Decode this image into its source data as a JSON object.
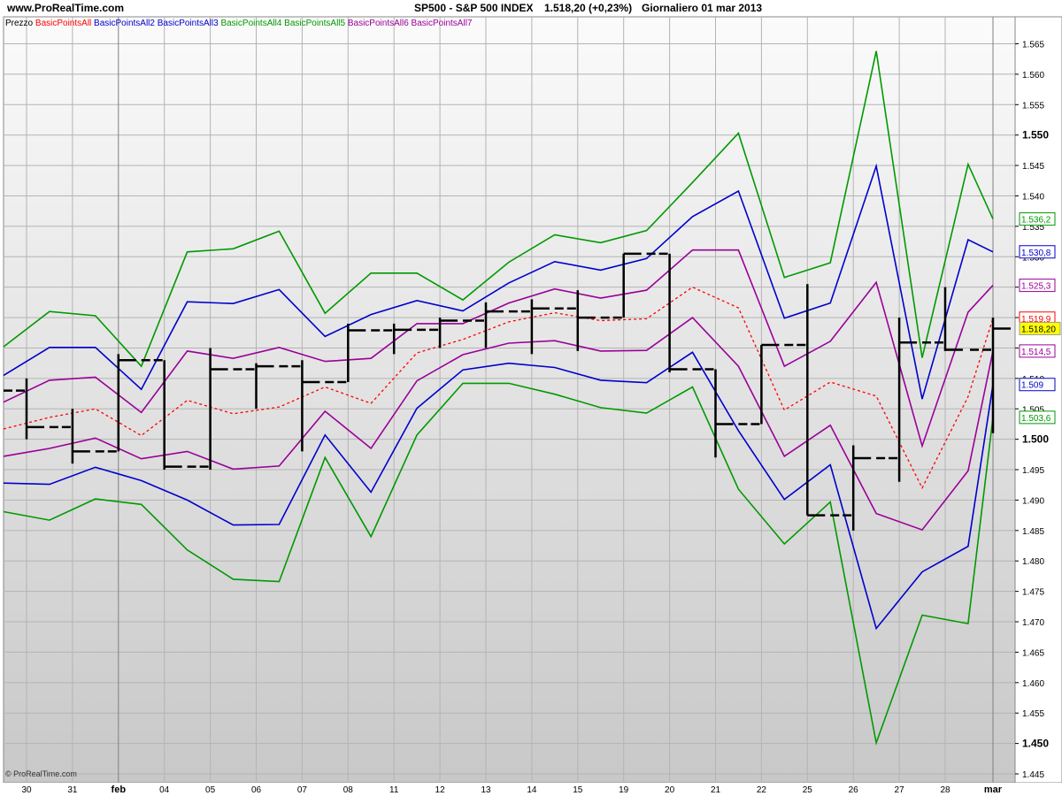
{
  "header": {
    "site": "www.ProRealTime.com",
    "instrument": "SP500 - S&P 500 INDEX",
    "price_change": "1.518,20 (+0,23%)",
    "timeframe_date": "Giornaliero  01 mar 2013"
  },
  "legend": [
    {
      "text": "Prezzo",
      "color": "#000000"
    },
    {
      "text": "BasicPointsAll",
      "color": "#ff0000"
    },
    {
      "text": "BasicPointsAll2",
      "color": "#0000cc"
    },
    {
      "text": "BasicPointsAll3",
      "color": "#0000cc"
    },
    {
      "text": "BasicPointsAll4",
      "color": "#009900"
    },
    {
      "text": "BasicPointsAll5",
      "color": "#009900"
    },
    {
      "text": "BasicPointsAll6",
      "color": "#990099"
    },
    {
      "text": "BasicPointsAll7",
      "color": "#990099"
    }
  ],
  "copyright": "© ProRealTime.com",
  "chart_data": {
    "type": "line",
    "ylim": [
      1444,
      1570
    ],
    "y_ticks": [
      "1.565",
      "1.560",
      "1.555",
      "1.550",
      "1.545",
      "1.540",
      "1.535",
      "1.530",
      "1.525",
      "1.520",
      "1.515",
      "1.510",
      "1.505",
      "1.500",
      "1.495",
      "1.490",
      "1.485",
      "1.480",
      "1.475",
      "1.470",
      "1.465",
      "1.460",
      "1.455",
      "1.450",
      "1.445"
    ],
    "y_ticks_bold": [
      "1.550",
      "1.500",
      "1.450"
    ],
    "x_labels": [
      "30",
      "31",
      "feb",
      "04",
      "05",
      "06",
      "07",
      "08",
      "11",
      "12",
      "13",
      "14",
      "15",
      "19",
      "20",
      "21",
      "22",
      "25",
      "26",
      "27",
      "28",
      "mar"
    ],
    "x_labels_bold": [
      "feb",
      "mar"
    ],
    "series": [
      {
        "name": "BasicPointsAll",
        "color": "#ff0000",
        "dashed": true,
        "values": [
          1501.7,
          1503.6,
          1505.0,
          1500.6,
          1506.4,
          1504.2,
          1505.3,
          1508.6,
          1505.9,
          1514.2,
          1516.4,
          1519.3,
          1520.8,
          1519.5,
          1519.8,
          1525.0,
          1521.6,
          1504.8,
          1509.4,
          1507.1,
          1492.0,
          1507.0,
          1519.9
        ],
        "end_label": "1.519,9",
        "end_label_value": 1519.9
      },
      {
        "name": "BasicPointsAll2",
        "color": "#0000cc",
        "dashed": false,
        "values": [
          1510.5,
          1515.1,
          1515.1,
          1508.2,
          1522.6,
          1522.3,
          1524.6,
          1516.9,
          1520.5,
          1522.8,
          1521.1,
          1525.7,
          1529.2,
          1527.8,
          1529.7,
          1536.6,
          1540.8,
          1519.9,
          1522.4,
          1544.9,
          1506.6,
          1532.8,
          1530.8
        ],
        "end_label": "1.530,8",
        "end_label_value": 1530.8
      },
      {
        "name": "BasicPointsAll3",
        "color": "#0000cc",
        "dashed": false,
        "values": [
          1492.8,
          1492.6,
          1495.4,
          1493.2,
          1490.0,
          1485.9,
          1486.0,
          1500.7,
          1491.3,
          1505.1,
          1511.4,
          1512.5,
          1511.8,
          1509.7,
          1509.3,
          1514.3,
          1501.4,
          1490.1,
          1495.8,
          1468.9,
          1478.2,
          1482.4,
          1509.0
        ],
        "end_label": "1.509",
        "end_label_value": 1509.0
      },
      {
        "name": "BasicPointsAll4",
        "color": "#009900",
        "dashed": false,
        "values": [
          1515.2,
          1521.0,
          1520.3,
          1512.0,
          1530.8,
          1531.3,
          1534.2,
          1520.7,
          1527.3,
          1527.3,
          1522.9,
          1529.1,
          1533.6,
          1532.3,
          1534.3,
          1542.2,
          1550.3,
          1526.6,
          1529.0,
          1563.8,
          1513.4,
          1545.2,
          1536.2
        ],
        "end_label": "1.536,2",
        "end_label_value": 1536.2
      },
      {
        "name": "BasicPointsAll5",
        "color": "#009900",
        "dashed": false,
        "values": [
          1488.1,
          1486.7,
          1490.2,
          1489.3,
          1481.8,
          1477.0,
          1476.6,
          1497.0,
          1484.0,
          1500.7,
          1509.2,
          1509.2,
          1507.4,
          1505.2,
          1504.3,
          1508.6,
          1491.8,
          1482.8,
          1489.7,
          1450.1,
          1471.1,
          1469.7,
          1503.6
        ],
        "end_label": "1.503,6",
        "end_label_value": 1503.6
      },
      {
        "name": "BasicPointsAll6",
        "color": "#990099",
        "dashed": false,
        "values": [
          1506.1,
          1509.7,
          1510.2,
          1504.4,
          1514.5,
          1513.3,
          1515.1,
          1512.8,
          1513.3,
          1519.0,
          1519.0,
          1522.4,
          1524.7,
          1523.2,
          1524.5,
          1531.1,
          1531.1,
          1512.0,
          1516.1,
          1525.8,
          1498.9,
          1520.9,
          1525.3
        ],
        "end_label": "1.525,3",
        "end_label_value": 1525.3
      },
      {
        "name": "BasicPointsAll7",
        "color": "#990099",
        "dashed": false,
        "values": [
          1497.2,
          1498.5,
          1500.2,
          1496.8,
          1498.0,
          1495.1,
          1495.6,
          1504.6,
          1498.5,
          1509.6,
          1513.9,
          1515.8,
          1516.2,
          1514.5,
          1514.6,
          1520.0,
          1512.0,
          1497.2,
          1502.3,
          1487.8,
          1485.1,
          1494.8,
          1514.5
        ],
        "end_label": "1.514,5",
        "end_label_value": 1514.5
      }
    ],
    "price_bars": {
      "name": "Prezzo",
      "color": "#000000",
      "note": "OHLC bars",
      "bars": [
        {
          "d": "30",
          "o": 1508.0,
          "h": 1510.0,
          "l": 1500.0,
          "c": 1502.0
        },
        {
          "d": "31",
          "o": 1502.0,
          "h": 1505.0,
          "l": 1496.0,
          "c": 1498.0
        },
        {
          "d": "feb",
          "o": 1498.0,
          "h": 1514.0,
          "l": 1498.0,
          "c": 1513.0
        },
        {
          "d": "04",
          "o": 1513.0,
          "h": 1513.0,
          "l": 1495.0,
          "c": 1495.5
        },
        {
          "d": "05",
          "o": 1495.5,
          "h": 1515.0,
          "l": 1495.0,
          "c": 1511.5
        },
        {
          "d": "06",
          "o": 1511.5,
          "h": 1512.5,
          "l": 1505.0,
          "c": 1512.0
        },
        {
          "d": "07",
          "o": 1512.0,
          "h": 1513.0,
          "l": 1498.0,
          "c": 1509.4
        },
        {
          "d": "08",
          "o": 1509.4,
          "h": 1519.0,
          "l": 1509.4,
          "c": 1517.9
        },
        {
          "d": "11",
          "o": 1517.9,
          "h": 1519.0,
          "l": 1514.0,
          "c": 1518.0
        },
        {
          "d": "12",
          "o": 1518.0,
          "h": 1520.0,
          "l": 1515.0,
          "c": 1519.5
        },
        {
          "d": "13",
          "o": 1519.5,
          "h": 1522.5,
          "l": 1515.0,
          "c": 1521.0
        },
        {
          "d": "14",
          "o": 1521.0,
          "h": 1523.0,
          "l": 1514.0,
          "c": 1521.5
        },
        {
          "d": "15",
          "o": 1521.5,
          "h": 1524.5,
          "l": 1514.5,
          "c": 1520.0
        },
        {
          "d": "19",
          "o": 1520.0,
          "h": 1530.5,
          "l": 1520.0,
          "c": 1530.5
        },
        {
          "d": "20",
          "o": 1530.5,
          "h": 1530.5,
          "l": 1511.0,
          "c": 1511.5
        },
        {
          "d": "21",
          "o": 1511.5,
          "h": 1511.5,
          "l": 1497.0,
          "c": 1502.5
        },
        {
          "d": "22",
          "o": 1502.5,
          "h": 1515.5,
          "l": 1502.5,
          "c": 1515.5
        },
        {
          "d": "25",
          "o": 1515.5,
          "h": 1525.5,
          "l": 1487.5,
          "c": 1487.5
        },
        {
          "d": "26",
          "o": 1487.5,
          "h": 1499.0,
          "l": 1485.0,
          "c": 1496.9
        },
        {
          "d": "27",
          "o": 1496.9,
          "h": 1520.0,
          "l": 1493.0,
          "c": 1515.9
        },
        {
          "d": "28",
          "o": 1515.9,
          "h": 1525.0,
          "l": 1514.5,
          "c": 1514.7
        },
        {
          "d": "mar",
          "o": 1514.7,
          "h": 1520.0,
          "l": 1501.0,
          "c": 1518.2
        }
      ],
      "last_label": "1.518,20",
      "last_value": 1518.2
    }
  }
}
